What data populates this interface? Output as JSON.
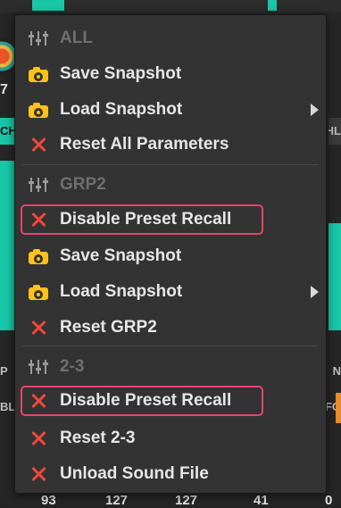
{
  "background": {
    "left_number": "7",
    "left_label_1": "CH",
    "right_label_1": "HL",
    "left_label_2": "P",
    "left_label_3": "BL",
    "right_label_2": "N",
    "right_label_3": "FO",
    "bottom_numbers": [
      "93",
      "127",
      "127",
      "41",
      "0"
    ]
  },
  "menu": {
    "sections": [
      {
        "header": "ALL",
        "items": [
          {
            "label": "Save Snapshot",
            "icon": "camera-icon"
          },
          {
            "label": "Load Snapshot",
            "icon": "camera-icon",
            "submenu": true
          },
          {
            "label": "Reset All Parameters",
            "icon": "x-icon"
          }
        ]
      },
      {
        "header": "GRP2",
        "items": [
          {
            "label": "Disable Preset Recall",
            "icon": "x-icon",
            "highlighted": true
          },
          {
            "label": "Save Snapshot",
            "icon": "camera-icon"
          },
          {
            "label": "Load Snapshot",
            "icon": "camera-icon",
            "submenu": true
          },
          {
            "label": "Reset GRP2",
            "icon": "x-icon"
          }
        ]
      },
      {
        "header": "2-3",
        "items": [
          {
            "label": "Disable Preset Recall",
            "icon": "x-icon",
            "highlighted": true
          },
          {
            "label": "Reset 2-3",
            "icon": "x-icon"
          },
          {
            "label": "Unload Sound File",
            "icon": "x-icon"
          }
        ]
      }
    ]
  },
  "colors": {
    "menu_bg": "#333334",
    "header_text": "#6f6f6f",
    "item_text": "#e6e6e6",
    "camera_icon": "#ffc21a",
    "x_icon": "#f0473a",
    "highlight_border": "#e9436d",
    "accent_teal": "#19c6a7"
  }
}
